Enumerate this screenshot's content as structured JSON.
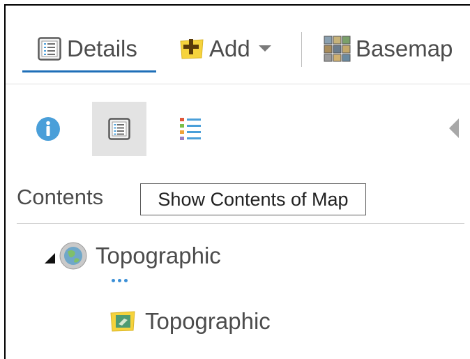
{
  "toolbar": {
    "details_label": "Details",
    "add_label": "Add",
    "basemap_label": "Basemap"
  },
  "tools": {
    "about_icon": "info-icon",
    "content_icon": "content-list-icon",
    "legend_icon": "legend-icon",
    "active": "content"
  },
  "contents": {
    "title": "Contents",
    "tooltip": "Show Contents of Map"
  },
  "layers": {
    "basemap_group": "Topographic",
    "basemap_layer": "Topographic"
  },
  "colors": {
    "accent": "#1f6fb8",
    "info_blue": "#4a9fd9",
    "active_tool_bg": "#e3e3e3",
    "dots_blue": "#3b8fd6"
  }
}
